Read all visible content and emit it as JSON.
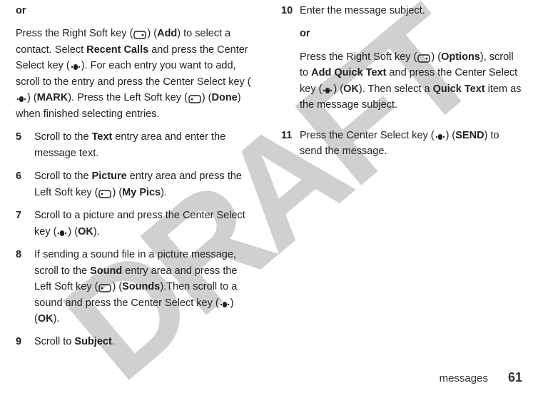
{
  "watermark": "DRAFT",
  "left": {
    "or": "or",
    "intro_1": "Press the Right Soft key (",
    "intro_2": ") (",
    "add_label": "Add",
    "intro_3": ") to select a contact. Select ",
    "recent_calls": "Recent Calls",
    "intro_4": " and press the Center Select key (",
    "intro_5": "). For each entry you want to add, scroll to the entry and press the Center Select key (",
    "intro_6": ") (",
    "mark": "MARK",
    "intro_7": "). Press the Left Soft key (",
    "intro_8": ") (",
    "done": "Done",
    "intro_9": ") when finished selecting entries.",
    "s5_a": "Scroll to the ",
    "s5_text": "Text",
    "s5_b": " entry area and enter the message text.",
    "s6_a": "Scroll to the ",
    "s6_picture": "Picture",
    "s6_b": " entry area and press the Left Soft key (",
    "s6_c": ") (",
    "s6_mypics": "My Pics",
    "s6_d": ").",
    "s7_a": "Scroll to a picture and press the Center Select key (",
    "s7_b": ") (",
    "s7_ok": "OK",
    "s7_c": ").",
    "s8_a": "If sending a sound file in a picture message, scroll to the ",
    "s8_sound": "Sound",
    "s8_b": " entry area and press the Left Soft key (",
    "s8_c": ") (",
    "s8_sounds": "Sounds",
    "s8_d": ").Then scroll to a sound and press the Center Select key (",
    "s8_e": ") (",
    "s8_ok": "OK",
    "s8_f": ").",
    "s9_a": "Scroll to ",
    "s9_subject": "Subject",
    "s9_b": "."
  },
  "right": {
    "s10": "Enter the message subject.",
    "or": "or",
    "p_a": "Press the Right Soft key (",
    "p_b": ") (",
    "options": "Options",
    "p_c": "), scroll to ",
    "addquick": "Add Quick Text",
    "p_d": " and press the Center Select key (",
    "p_e": ") (",
    "ok1": "OK",
    "p_f": "). Then select a ",
    "quicktext": "Quick Text",
    "p_g": " item as the message subject.",
    "s11_a": "Press the Center Select key (",
    "s11_b": ") (",
    "send": "SEND",
    "s11_c": ") to send the message."
  },
  "nums": {
    "n5": "5",
    "n6": "6",
    "n7": "7",
    "n8": "8",
    "n9": "9",
    "n10": "10",
    "n11": "11"
  },
  "footer": {
    "section": "messages",
    "page": "61"
  }
}
